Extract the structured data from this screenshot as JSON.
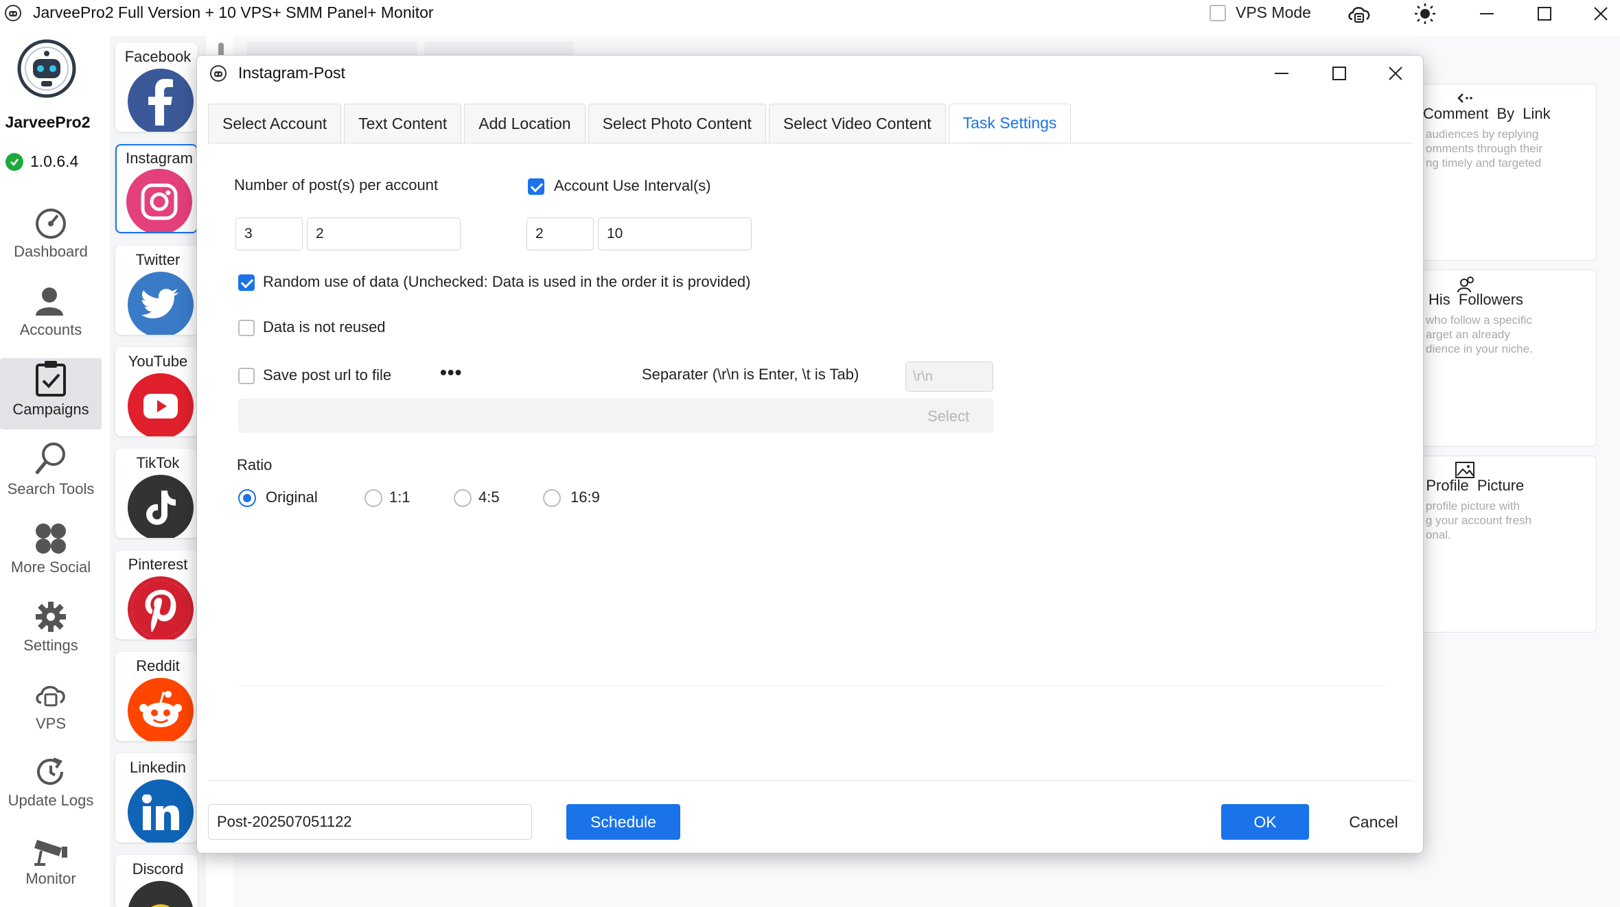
{
  "app": {
    "title": "JarveePro2 Full Version + 10 VPS+ SMM Panel+ Monitor",
    "vps_mode_label": "VPS Mode",
    "vps_mode_checked": false,
    "brand": "JarveePro2",
    "version": "1.0.6.4"
  },
  "nav": {
    "items": [
      {
        "label": "Dashboard",
        "icon": "dashboard-icon",
        "active": false
      },
      {
        "label": "Accounts",
        "icon": "accounts-icon",
        "active": false
      },
      {
        "label": "Campaigns",
        "icon": "campaigns-icon",
        "active": true
      },
      {
        "label": "Search Tools",
        "icon": "search-icon",
        "active": false
      },
      {
        "label": "More Social",
        "icon": "more-social-icon",
        "active": false
      },
      {
        "label": "Settings",
        "icon": "gear-icon",
        "active": false
      },
      {
        "label": "VPS",
        "icon": "vps-icon",
        "active": false
      },
      {
        "label": "Update Logs",
        "icon": "update-logs-icon",
        "active": false
      },
      {
        "label": "Monitor",
        "icon": "monitor-icon",
        "active": false
      }
    ]
  },
  "social": {
    "items": [
      {
        "label": "Facebook",
        "icon": "facebook-icon",
        "color": "#3b5998",
        "selected": false
      },
      {
        "label": "Instagram",
        "icon": "instagram-icon",
        "color": "#e4407b",
        "selected": true
      },
      {
        "label": "Twitter",
        "icon": "twitter-icon",
        "color": "#3a7bc8",
        "selected": false
      },
      {
        "label": "YouTube",
        "icon": "youtube-icon",
        "color": "#e0202c",
        "selected": false
      },
      {
        "label": "TikTok",
        "icon": "tiktok-icon",
        "color": "#333333",
        "selected": false
      },
      {
        "label": "Pinterest",
        "icon": "pinterest-icon",
        "color": "#d32030",
        "selected": false
      },
      {
        "label": "Reddit",
        "icon": "reddit-icon",
        "color": "#ff4500",
        "selected": false
      },
      {
        "label": "Linkedin",
        "icon": "linkedin-icon",
        "color": "#0f64b8",
        "selected": false
      },
      {
        "label": "Discord",
        "icon": "discord-icon",
        "color": "#333333",
        "selected": false
      }
    ]
  },
  "cards": [
    {
      "title": "Comment  By  Link",
      "desc": "audiences by replying\nomments through their\nng timely and targeted",
      "icon": "comment-icon"
    },
    {
      "title": "w  His  Followers",
      "desc": "who follow a specific\narget an already\ndience in your niche.",
      "icon": "followers-icon"
    },
    {
      "title": "e  Profile  Picture",
      "desc": "profile picture with\ng your account fresh\nonal.",
      "icon": "picture-icon"
    }
  ],
  "dialog": {
    "title": "Instagram-Post",
    "tabs": [
      {
        "label": "Select Account",
        "active": false
      },
      {
        "label": "Text Content",
        "active": false
      },
      {
        "label": "Add Location",
        "active": false
      },
      {
        "label": "Select Photo Content",
        "active": false
      },
      {
        "label": "Select Video Content",
        "active": false
      },
      {
        "label": "Task Settings",
        "active": true
      }
    ],
    "posts_label": "Number of post(s) per account",
    "posts_min": "3",
    "posts_max": "2",
    "interval_label": "Account Use Interval(s)",
    "interval_checked": true,
    "interval_min": "2",
    "interval_max": "10",
    "random_label": "Random use of data (Unchecked: Data is used in the order it is provided)",
    "random_checked": true,
    "not_reused_label": "Data is not reused",
    "not_reused_checked": false,
    "save_url_label": "Save post url to file",
    "save_url_checked": false,
    "more_label": "•••",
    "separator_label": "Separater (\\r\\n is Enter, \\t is Tab)",
    "separator_value": "\\r\\n",
    "select_label": "Select",
    "ratio_label": "Ratio",
    "ratios": [
      {
        "label": "Original",
        "checked": true
      },
      {
        "label": "1:1",
        "checked": false
      },
      {
        "label": "4:5",
        "checked": false
      },
      {
        "label": "16:9",
        "checked": false
      }
    ],
    "task_name": "Post-202507051122",
    "schedule_label": "Schedule",
    "ok_label": "OK",
    "cancel_label": "Cancel"
  }
}
